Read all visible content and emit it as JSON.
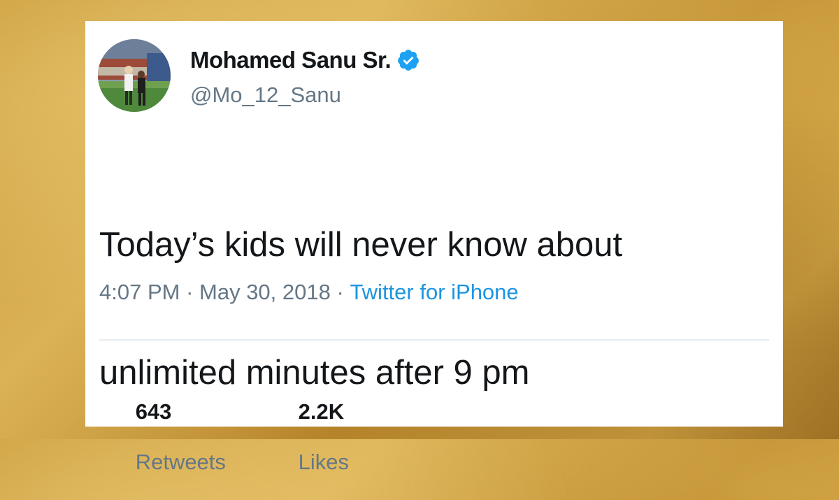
{
  "tweet": {
    "author": {
      "display_name": "Mohamed Sanu Sr.",
      "handle": "@Mo_12_Sanu",
      "verified": true
    },
    "text_lines": [
      "Today’s kids will never know about",
      "unlimited minutes after 9 pm"
    ],
    "meta": {
      "time": "4:07 PM",
      "separator": " · ",
      "date": "May 30, 2018",
      "source": "Twitter for iPhone"
    },
    "stats": {
      "retweets_count": "643",
      "retweets_label": "Retweets",
      "likes_count": "2.2K",
      "likes_label": "Likes"
    }
  },
  "colors": {
    "verified_badge": "#1da1f2",
    "source_link": "#1b95e0",
    "secondary_text": "#657786",
    "primary_text": "#14171a"
  },
  "icons": {
    "verified": "verified-badge-icon"
  }
}
